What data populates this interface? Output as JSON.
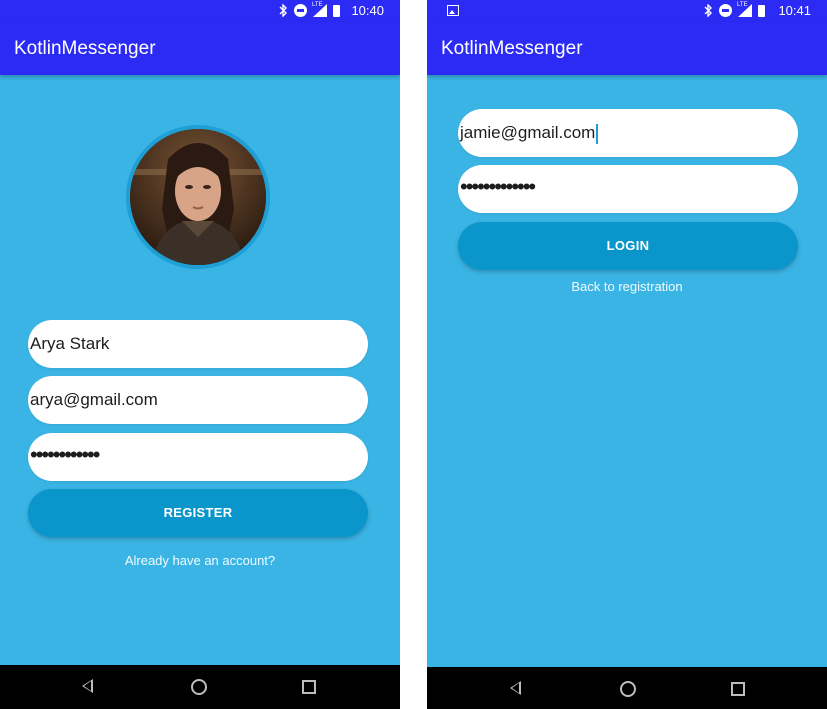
{
  "register_screen": {
    "status_time": "10:40",
    "app_title": "KotlinMessenger",
    "username_value": "Arya Stark",
    "email_value": "arya@gmail.com",
    "password_value": "••••••••••••",
    "register_button": "REGISTER",
    "login_link": "Already have an account?"
  },
  "login_screen": {
    "status_time": "10:41",
    "app_title": "KotlinMessenger",
    "email_value": "jamie@gmail.com",
    "password_value": "•••••••••••••",
    "login_button": "LOGIN",
    "register_link": "Back to registration"
  },
  "status_icons": [
    "bluetooth-icon",
    "do-not-disturb-icon",
    "lte-signal-icon",
    "battery-icon"
  ],
  "nav_icons": [
    "back-icon",
    "home-icon",
    "recents-icon"
  ],
  "colors": {
    "app_bar": "#2b2bf5",
    "background": "#3ab4e4",
    "button": "#0a96cb",
    "field": "#ffffff",
    "nav_bar": "#000000"
  }
}
